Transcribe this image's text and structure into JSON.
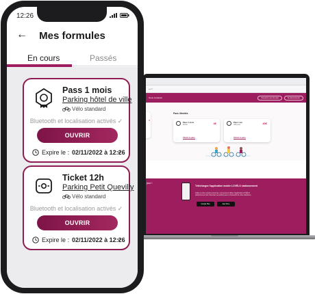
{
  "phone": {
    "status_time": "12:26",
    "title": "Mes formules",
    "tabs": [
      {
        "label": "En cours",
        "active": true
      },
      {
        "label": "Passés",
        "active": false
      }
    ],
    "tickets": [
      {
        "name": "Pass 1 mois",
        "parking": "Parking hôtel de ville",
        "velo_type": "Vélo standard",
        "status": "Bluetooth et localisation activés ✓",
        "button": "OUVRIR",
        "expire_label": "Expire le :",
        "expire_date": "02/11/2022 à 12:26",
        "icon": "pass-badge-icon"
      },
      {
        "name": "Ticket 12h",
        "parking": "Parking Petit Quevilly",
        "velo_type": "Vélo standard",
        "status": "Bluetooth et localisation activés ✓",
        "button": "OUVRIR",
        "expire_label": "Expire le :",
        "expire_date": "02/11/2022 à 12:26",
        "icon": "ticket-timer-icon"
      }
    ]
  },
  "laptop": {
    "header_left": "Nous contacter",
    "header_btn_1": "Souscrire une formule",
    "header_btn_2": "Se déconnecter",
    "section_title": "Pass illimités",
    "cards": [
      {
        "name": "Pass 1 mois",
        "sub": "Illimité",
        "price": "4€",
        "link": "Choisir ce pass"
      },
      {
        "name": "Pass 1 an",
        "sub": "365 jours",
        "price": "40€",
        "link": "Choisir ce pass"
      }
    ],
    "promo_left": "jour !",
    "promo_title": "Téléchargez l'application mobile LOVÉLO stationnement",
    "promo_desc": "Grâce à votre compte personnel, vous pouvez utiliser l'application LOVÉLO stationnement afin d'accéder au parking avec le bluetooth de votre téléphone",
    "store_1": "Google Play",
    "store_2": "App Store"
  },
  "colors": {
    "accent": "#9c1e5e",
    "ticket_border": "#8e1c52"
  }
}
